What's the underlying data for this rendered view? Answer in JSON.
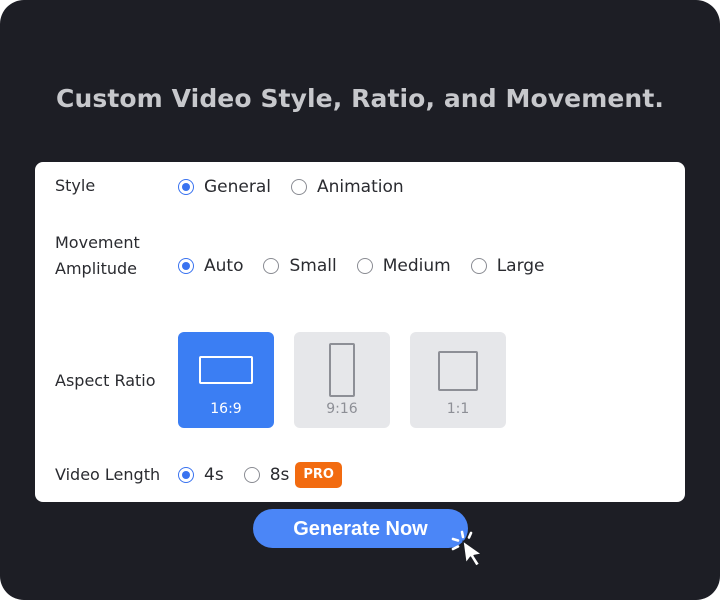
{
  "headline": "Custom Video Style, Ratio, and Movement.",
  "style": {
    "label": "Style",
    "options": [
      {
        "label": "General",
        "selected": true
      },
      {
        "label": "Animation",
        "selected": false
      }
    ]
  },
  "movement": {
    "label_line1": "Movement",
    "label_line2": "Amplitude",
    "options": [
      {
        "label": "Auto",
        "selected": true
      },
      {
        "label": "Small",
        "selected": false
      },
      {
        "label": "Medium",
        "selected": false
      },
      {
        "label": "Large",
        "selected": false
      }
    ]
  },
  "aspect_ratio": {
    "label": "Aspect Ratio",
    "options": [
      {
        "label": "16:9",
        "selected": true
      },
      {
        "label": "9:16",
        "selected": false
      },
      {
        "label": "1:1",
        "selected": false
      }
    ]
  },
  "video_length": {
    "label": "Video Length",
    "options": [
      {
        "label": "4s",
        "selected": true
      },
      {
        "label": "8s",
        "selected": false
      }
    ],
    "pro_badge": "PRO"
  },
  "generate_button": "Generate Now",
  "colors": {
    "background": "#1d1e25",
    "accent": "#3b7ef3",
    "pro_badge": "#f26b10",
    "button": "#4b86f7"
  },
  "icons": [
    "radio-icon",
    "landscape-ratio-icon",
    "portrait-ratio-icon",
    "square-ratio-icon",
    "click-cursor-icon"
  ]
}
